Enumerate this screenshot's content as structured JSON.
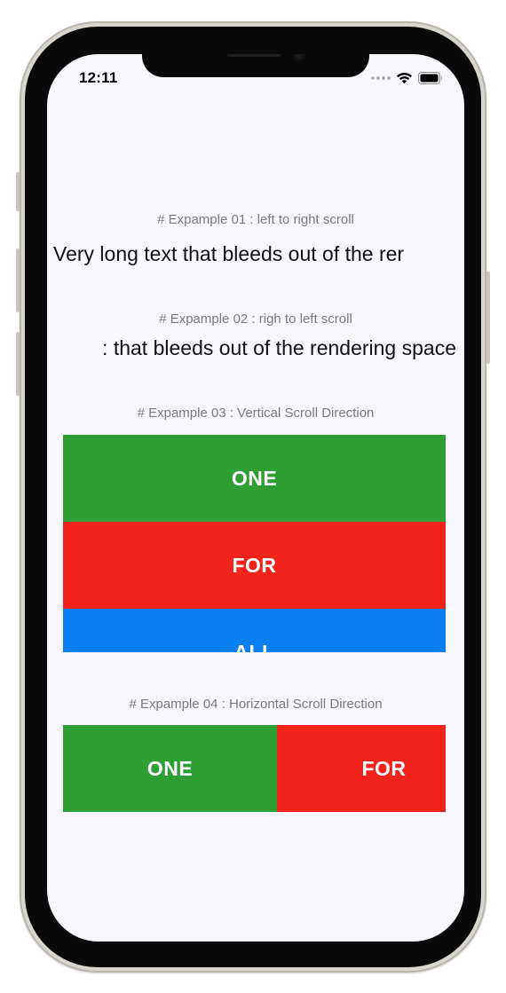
{
  "status_bar": {
    "time": "12:11",
    "icons": [
      "signal-dots-icon",
      "wifi-icon",
      "battery-icon"
    ]
  },
  "examples": {
    "ex1": {
      "caption": "# Expample 01 : left to right scroll",
      "text": "Very long text that bleeds out of the rer"
    },
    "ex2": {
      "caption": "# Expample 02 : righ to left scroll",
      "text": ": that bleeds out of the rendering space"
    },
    "ex3": {
      "caption": "# Expample 03 : Vertical Scroll Direction",
      "panels": [
        {
          "label": "ONE",
          "color": "#2e9e35"
        },
        {
          "label": "FOR",
          "color": "#f2231a"
        },
        {
          "label": "ALL",
          "color": "#0a7ff2"
        }
      ]
    },
    "ex4": {
      "caption": "# Expample 04 : Horizontal Scroll Direction",
      "panels": [
        {
          "label": "ONE",
          "color": "#2e9e35"
        },
        {
          "label": "FOR",
          "color": "#f2231a"
        }
      ]
    }
  }
}
